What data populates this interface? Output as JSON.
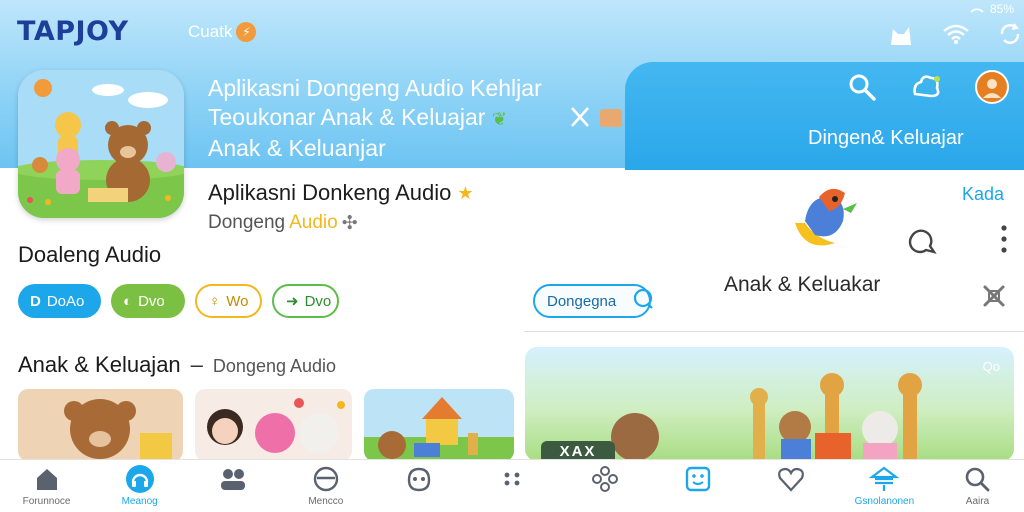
{
  "header": {
    "logo": "TAPJOY",
    "chip_label": "Cuatk",
    "status_text": "85%"
  },
  "banner": {
    "line1": "Aplikasni Dongeng Audio Kehljar",
    "line2": "Teoukonar Anak & Keluajar",
    "line3": "Anak & Keluanjar",
    "right_title": "Dingen& Keluajar"
  },
  "app": {
    "title": "Aplikasni Donkeng Audio",
    "subtitle_prefix": "Dongeng",
    "subtitle_highlight": "Audio",
    "section_title": "Doaleng Audio",
    "right_link": "Kada",
    "right_caption": "Anak & Keluakar",
    "search_pill": "Dongegna"
  },
  "pills": [
    {
      "label": "DoAo",
      "style": "blue"
    },
    {
      "label": "Dvo",
      "style": "green"
    },
    {
      "label": "Wo",
      "style": "outline-y"
    },
    {
      "label": "Dvo",
      "style": "outline-g"
    }
  ],
  "section2": {
    "title": "Anak & Keluajan",
    "separator": "–",
    "subtitle": "Dongeng Audio"
  },
  "feature": {
    "label": "Qo",
    "tag": "XAX"
  },
  "bottom_nav": [
    {
      "label": "Forunnoce",
      "icon": "home-icon",
      "active": false
    },
    {
      "label": "Meanog",
      "icon": "headphones-icon",
      "active": true
    },
    {
      "label": "",
      "icon": "users-icon",
      "active": false
    },
    {
      "label": "Mencco",
      "icon": "bowl-icon",
      "active": false
    },
    {
      "label": "",
      "icon": "face-icon",
      "active": false
    },
    {
      "label": "",
      "icon": "dots-icon",
      "active": false
    },
    {
      "label": "",
      "icon": "flower-icon",
      "active": false
    },
    {
      "label": "",
      "icon": "smile-square-icon",
      "active": false
    },
    {
      "label": "",
      "icon": "heart-icon",
      "active": false
    },
    {
      "label": "Gsnolanonen",
      "icon": "tent-icon",
      "active": true
    },
    {
      "label": "Aaira",
      "icon": "search-icon",
      "active": false
    }
  ],
  "colors": {
    "accent": "#1ca7ea",
    "green": "#7bc043",
    "yellow": "#f3b81f",
    "logo_dark": "#1d3f9a"
  }
}
